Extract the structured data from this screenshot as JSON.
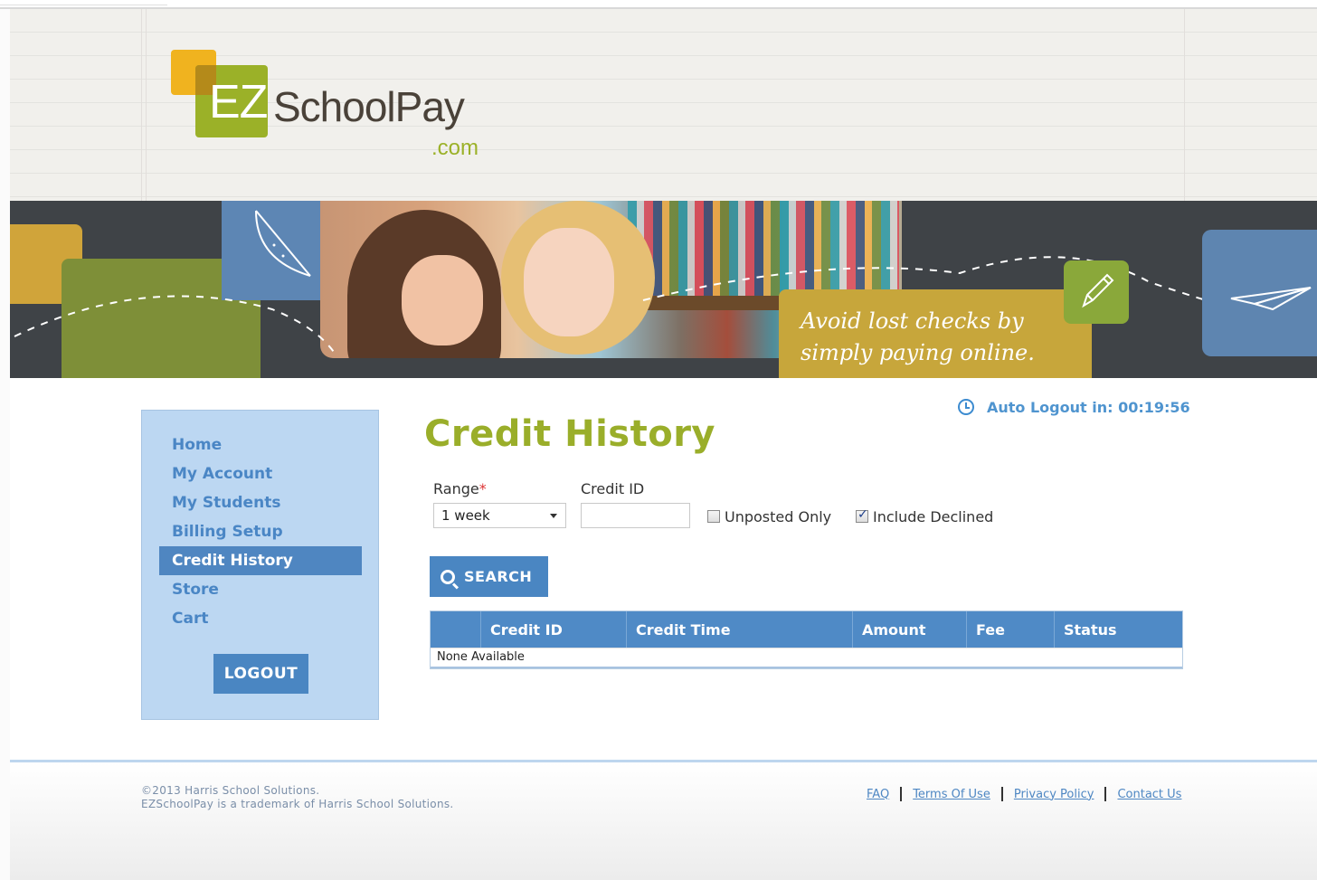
{
  "brand": {
    "logo_ez": "EZ",
    "logo_name": "SchoolPay",
    "logo_tld": ".com"
  },
  "banner": {
    "tagline_line1": "Avoid lost checks by",
    "tagline_line2": "simply paying online."
  },
  "session": {
    "auto_logout": "Auto Logout in: 00:19:56"
  },
  "sidebar": {
    "items": [
      {
        "label": "Home"
      },
      {
        "label": "My Account"
      },
      {
        "label": "My Students"
      },
      {
        "label": "Billing Setup"
      },
      {
        "label": "Credit History",
        "active": true
      },
      {
        "label": "Store"
      },
      {
        "label": "Cart"
      }
    ],
    "logout_label": "LOGOUT"
  },
  "main": {
    "title": "Credit History",
    "range_label": "Range",
    "range_required_mark": "*",
    "range_value": "1 week",
    "credit_id_label": "Credit ID",
    "credit_id_value": "",
    "unposted_label": "Unposted Only",
    "unposted_checked": false,
    "declined_label": "Include Declined",
    "declined_checked": true,
    "search_label": "SEARCH"
  },
  "table": {
    "columns": [
      "",
      "Credit ID",
      "Credit Time",
      "Amount",
      "Fee",
      "Status"
    ],
    "empty_text": "None Available"
  },
  "footer": {
    "copyright_line1": "©2013 Harris School Solutions.",
    "copyright_line2": "EZSchoolPay is a trademark of Harris School Solutions.",
    "links": [
      "FAQ",
      "Terms Of Use",
      "Privacy Policy",
      "Contact Us"
    ]
  },
  "colors": {
    "accent_blue": "#4a86c2",
    "brand_green": "#9bb128",
    "brand_orange": "#f0b31f",
    "sidebar_bg": "#bcd7f2"
  }
}
